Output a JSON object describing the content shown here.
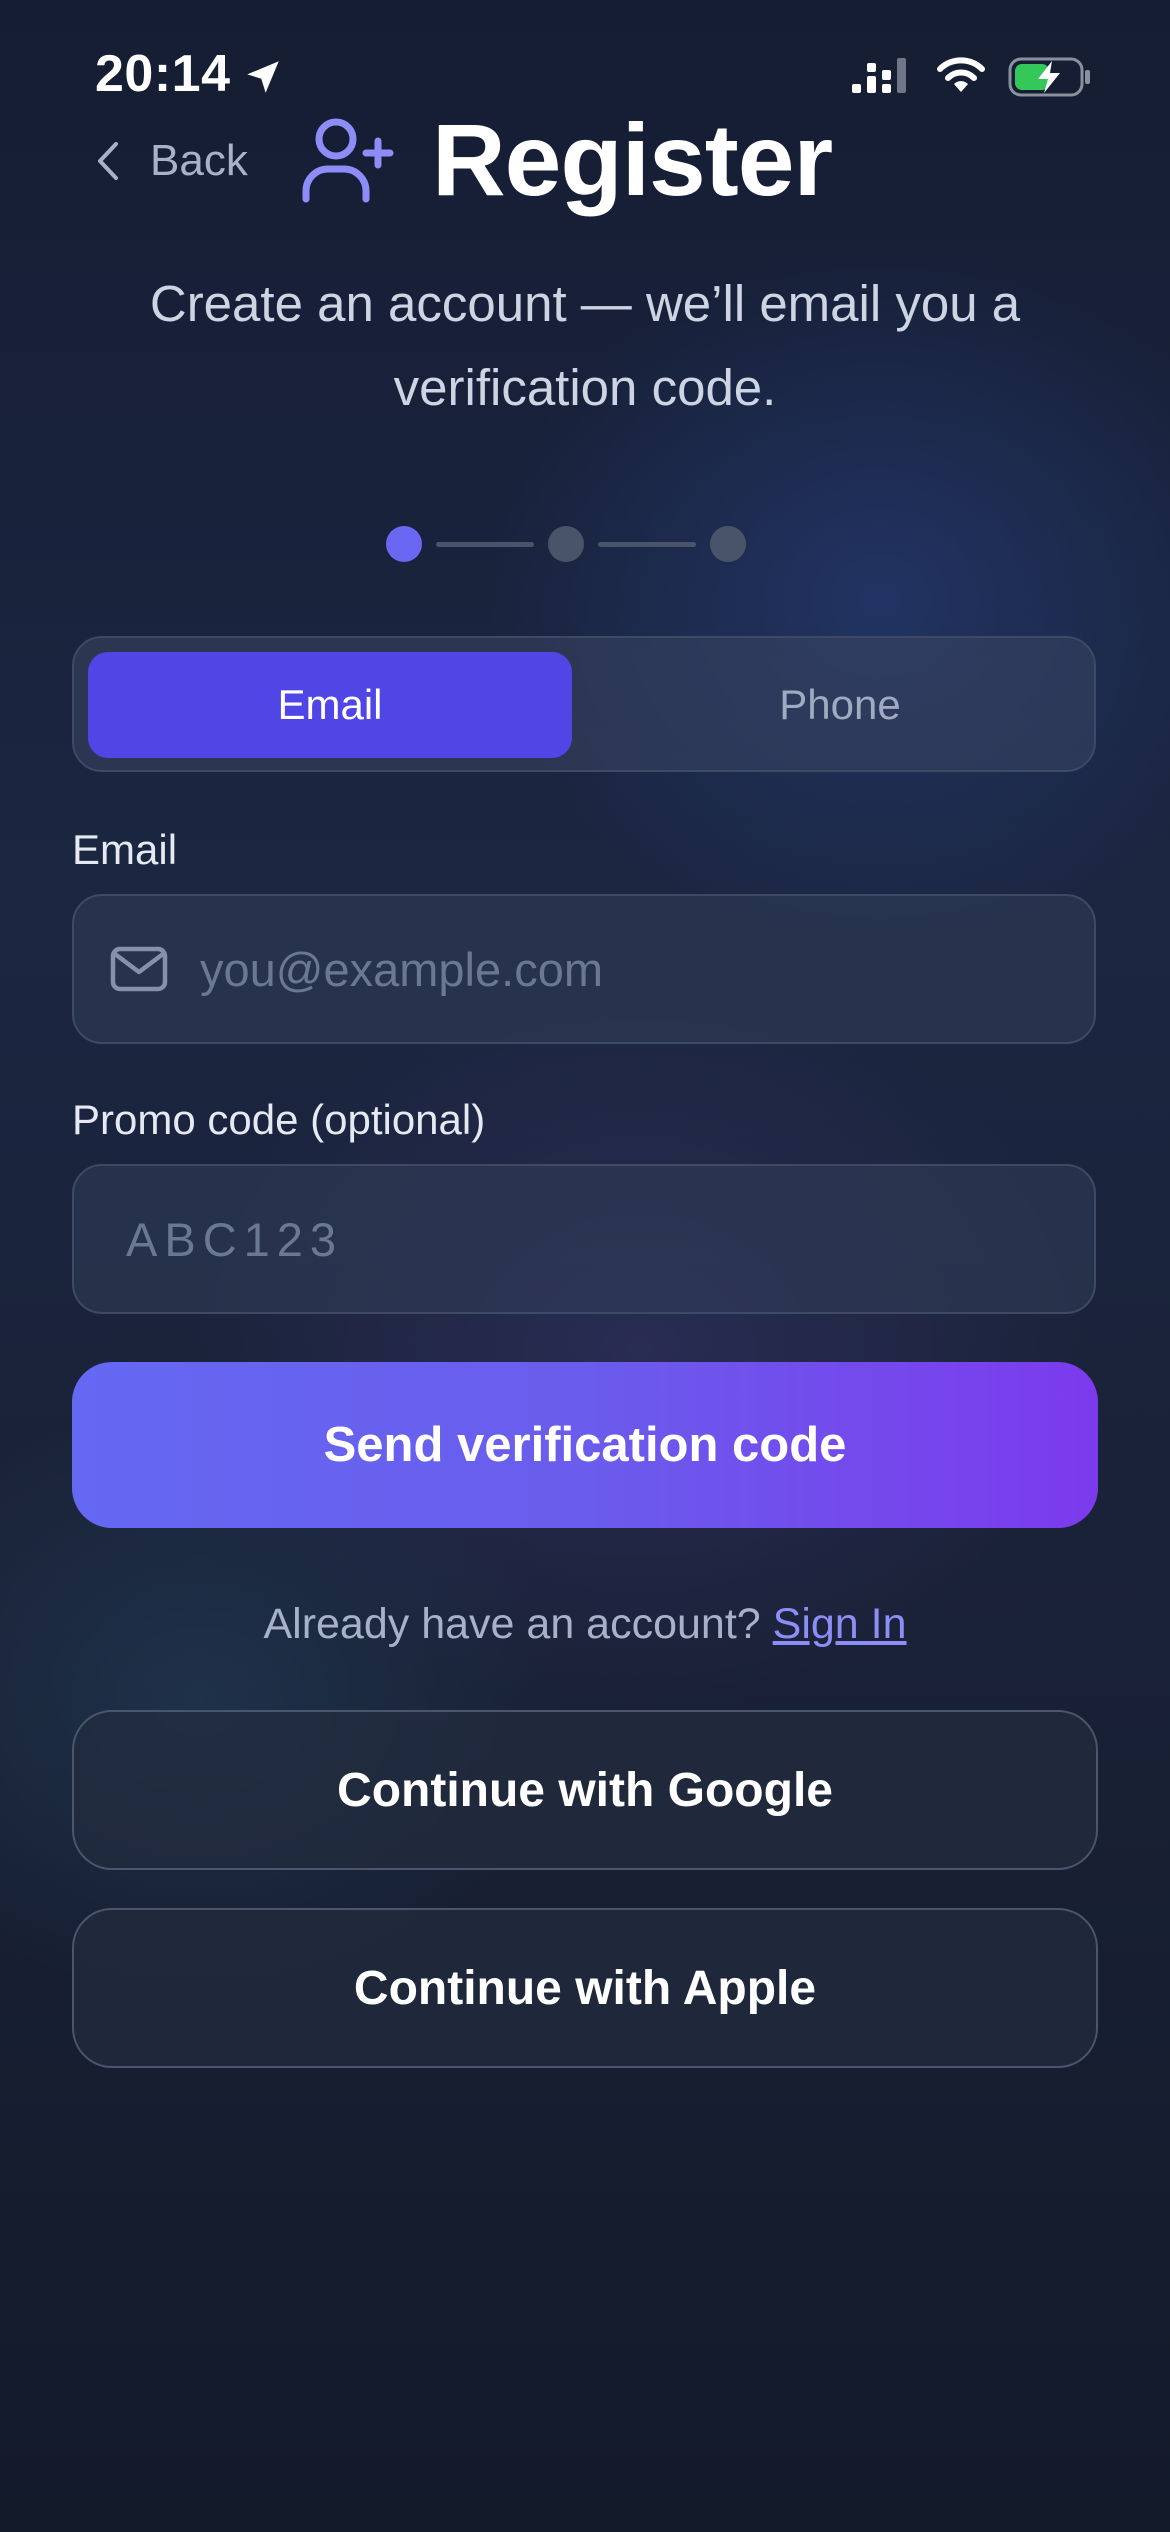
{
  "status_bar": {
    "time": "20:14",
    "icons": [
      "location-arrow-icon",
      "cellular-signal-icon",
      "wifi-icon",
      "battery-charging-icon"
    ],
    "battery_color": "#34c759"
  },
  "header": {
    "back_label": "Back",
    "title": "Register",
    "title_icon": "user-plus-icon",
    "subtitle": "Create an account — we’ll email you a verification code."
  },
  "stepper": {
    "total_steps": 3,
    "current_step": 1
  },
  "method_tabs": [
    {
      "label": "Email",
      "selected": true
    },
    {
      "label": "Phone",
      "selected": false
    }
  ],
  "email_field": {
    "label": "Email",
    "placeholder": "you@example.com",
    "value": "",
    "icon": "mail-icon"
  },
  "promo_field": {
    "label": "Promo code (optional)",
    "placeholder": "ABC123",
    "value": ""
  },
  "primary_button": {
    "label": "Send verification code"
  },
  "signin": {
    "prompt": "Already have an account?",
    "link": "Sign In"
  },
  "social_buttons": {
    "google": "Continue with Google",
    "apple": "Continue with Apple"
  },
  "colors": {
    "accent": "#4f46e5",
    "gradient_start": "#6366f1",
    "gradient_end": "#7c3aed",
    "link": "#8d8df7"
  }
}
